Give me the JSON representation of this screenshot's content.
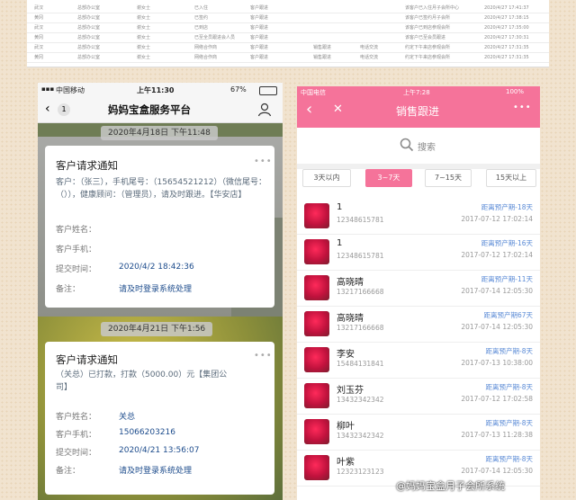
{
  "top_table": {
    "rows": [
      {
        "cells": [
          "武汉",
          "总部办公室",
          "谢女士",
          "已入住",
          "客户跟进",
          "",
          "",
          "",
          "该客户已入住月子会所中心",
          "2020/4/27 17:41:37"
        ]
      },
      {
        "cells": [
          "黄冈",
          "总部办公室",
          "谢女士",
          "已签约",
          "客户跟进",
          "",
          "",
          "",
          "该客户已签约月子会所",
          "2020/4/27 17:38:15"
        ]
      },
      {
        "cells": [
          "武汉",
          "总部办公室",
          "谢女士",
          "已到店",
          "客户跟进",
          "",
          "",
          "",
          "该客户已到店参观会所",
          "2020/4/27 17:35:00"
        ]
      },
      {
        "cells": [
          "黄冈",
          "总部办公室",
          "谢女士",
          "已至全员跟进会人员",
          "客户跟进",
          "",
          "",
          "",
          "该客户已至会员跟进",
          "2020/4/27 17:30:31"
        ]
      },
      {
        "cells": [
          "武汉",
          "总部办公室",
          "谢女士",
          "网络合作商",
          "客户跟进",
          "销售跟进",
          "电话交流",
          "",
          "约定下午来店参观会所",
          "2020/4/27 17:31:35"
        ]
      },
      {
        "cells": [
          "黄冈",
          "总部办公室",
          "谢女士",
          "网络合作商",
          "客户跟进",
          "销售跟进",
          "电话交流",
          "",
          "约定下午来店参观会所",
          "2020/4/27 17:31:35"
        ]
      }
    ]
  },
  "left_phone": {
    "status": {
      "carrier": "中国移动",
      "time": "上午11:30",
      "battery": "67%"
    },
    "nav": {
      "back_label": "1",
      "title": "妈妈宝盒服务平台"
    },
    "messages": [
      {
        "date": "2020年4月18日 下午11:48",
        "title": "客户请求通知",
        "dots": "•••",
        "body": "客户：（张三），手机尾号：（15654521212）（微信尾号：（）），健康顾问：（管理员），请及时跟进。【华安店】",
        "fields": [
          {
            "label": "客户姓名：",
            "value": ""
          },
          {
            "label": "客户手机：",
            "value": ""
          },
          {
            "label": "提交时间：",
            "value": "2020/4/2 18:42:36"
          },
          {
            "label": "备注：",
            "value": "请及时登录系统处理"
          }
        ]
      },
      {
        "date": "2020年4月21日 下午1:56",
        "title": "客户请求通知",
        "dots": "•••",
        "body": "（关总）已打款，打款（5000.00）元【集团公司】",
        "fields": [
          {
            "label": "客户姓名：",
            "value": "关总"
          },
          {
            "label": "客户手机：",
            "value": "15066203216"
          },
          {
            "label": "提交时间：",
            "value": "2020/4/21 13:56:07"
          },
          {
            "label": "备注：",
            "value": "请及时登录系统处理"
          }
        ]
      }
    ]
  },
  "right_phone": {
    "status": {
      "carrier": "中国电信",
      "time": "上午7:28",
      "battery": "100%"
    },
    "nav": {
      "title": "销售跟进",
      "more": "•••"
    },
    "search": {
      "placeholder": "搜索"
    },
    "filters": [
      "3天以内",
      "3~7天",
      "7~15天",
      "15天以上"
    ],
    "active_filter": 1,
    "leads": [
      {
        "name": "1",
        "phone": "12348615781",
        "status": "距离预产期-18天",
        "time": "2017-07-12 17:02:14"
      },
      {
        "name": "1",
        "phone": "12348615781",
        "status": "距离预产期-16天",
        "time": "2017-07-12 17:02:14"
      },
      {
        "name": "高晓晴",
        "phone": "13217166668",
        "status": "距离预产期-11天",
        "time": "2017-07-14 12:05:30"
      },
      {
        "name": "高晓晴",
        "phone": "13217166668",
        "status": "距离预产期67天",
        "time": "2017-07-14 12:05:30"
      },
      {
        "name": "李安",
        "phone": "15484131841",
        "status": "距离预产期-8天",
        "time": "2017-07-13 10:38:00"
      },
      {
        "name": "刘玉芬",
        "phone": "13432342342",
        "status": "距离预产期-8天",
        "time": "2017-07-12 17:02:58"
      },
      {
        "name": "柳叶",
        "phone": "13432342342",
        "status": "距离预产期-8天",
        "time": "2017-07-13 11:28:38"
      },
      {
        "name": "叶紫",
        "phone": "12323123123",
        "status": "距离预产期-8天",
        "time": "2017-07-14 12:05:30"
      }
    ]
  },
  "watermark": "@妈妈宝盒月子会所系统",
  "colors": {
    "accent_pink": "#f5739a",
    "link_blue": "#5b8bd6"
  }
}
